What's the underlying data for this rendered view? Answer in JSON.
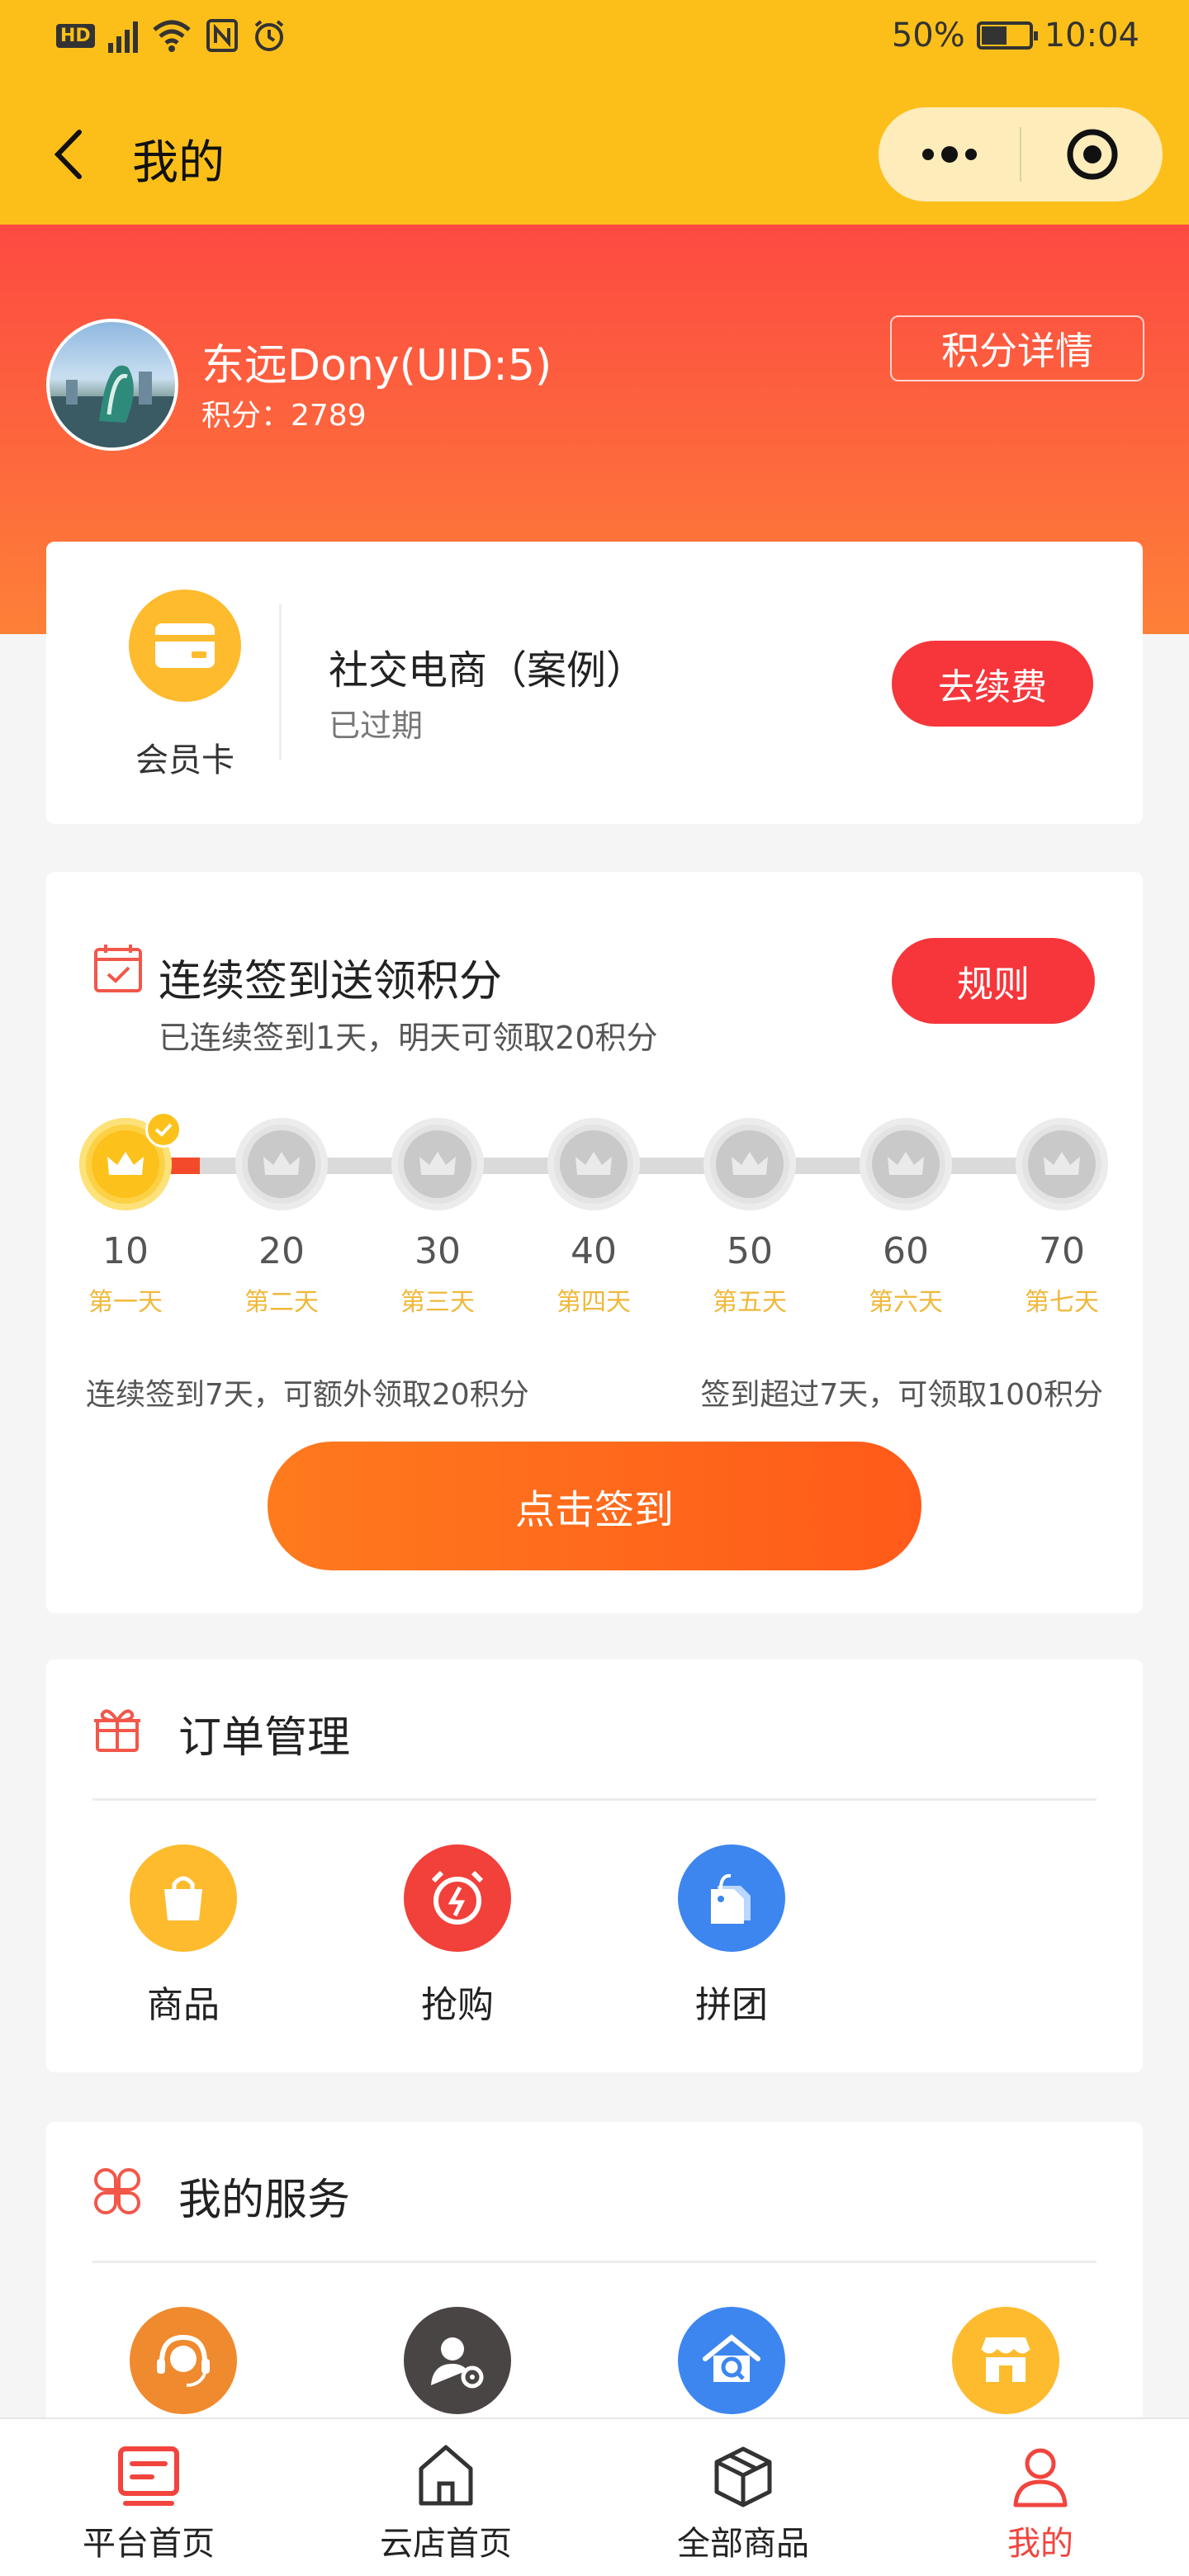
{
  "status_bar": {
    "battery": "50%",
    "battery_level": 0.5,
    "time": "10:04"
  },
  "title_bar": {
    "title": "我的"
  },
  "profile": {
    "name": "东远Dony(UID:5)",
    "points": "积分：2789",
    "detail_button": "积分详情"
  },
  "member": {
    "icon_label": "会员卡",
    "name": "社交电商（案例）",
    "status": "已过期",
    "renew_button": "去续费"
  },
  "sign_in": {
    "title": "连续签到送领积分",
    "subtitle": "已连续签到1天，明天可领取20积分",
    "rule_button": "规则",
    "days_signed": 1,
    "days": [
      {
        "points": "10",
        "label": "第一天"
      },
      {
        "points": "20",
        "label": "第二天"
      },
      {
        "points": "30",
        "label": "第三天"
      },
      {
        "points": "40",
        "label": "第四天"
      },
      {
        "points": "50",
        "label": "第五天"
      },
      {
        "points": "60",
        "label": "第六天"
      },
      {
        "points": "70",
        "label": "第七天"
      }
    ],
    "note_left": "连续签到7天，可额外领取20积分",
    "note_right": "签到超过7天，可领取100积分",
    "sign_button": "点击签到"
  },
  "orders": {
    "title": "订单管理",
    "items": [
      {
        "label": "商品",
        "icon": "shopping-bag-icon",
        "color": "#fdbb2d"
      },
      {
        "label": "抢购",
        "icon": "alarm-clock-icon",
        "color": "#f2403a"
      },
      {
        "label": "拼团",
        "icon": "tag-icon",
        "color": "#3d86f0"
      }
    ]
  },
  "services": {
    "title": "我的服务",
    "items": [
      {
        "icon": "headset-icon",
        "color": "#f08a2e"
      },
      {
        "icon": "user-settings-icon",
        "color": "#4a4545"
      },
      {
        "icon": "home-search-icon",
        "color": "#3d86f0"
      },
      {
        "icon": "store-icon",
        "color": "#fdbb2d"
      }
    ]
  },
  "tabbar": {
    "tabs": [
      {
        "label": "平台首页",
        "icon": "newspaper-icon"
      },
      {
        "label": "云店首页",
        "icon": "home-icon"
      },
      {
        "label": "全部商品",
        "icon": "box-icon"
      },
      {
        "label": "我的",
        "icon": "user-icon",
        "active": true
      }
    ]
  },
  "colors": {
    "brand_yellow": "#fcbf1a",
    "brand_red": "#f6363b",
    "sign_orange": "#ff6a1b"
  }
}
